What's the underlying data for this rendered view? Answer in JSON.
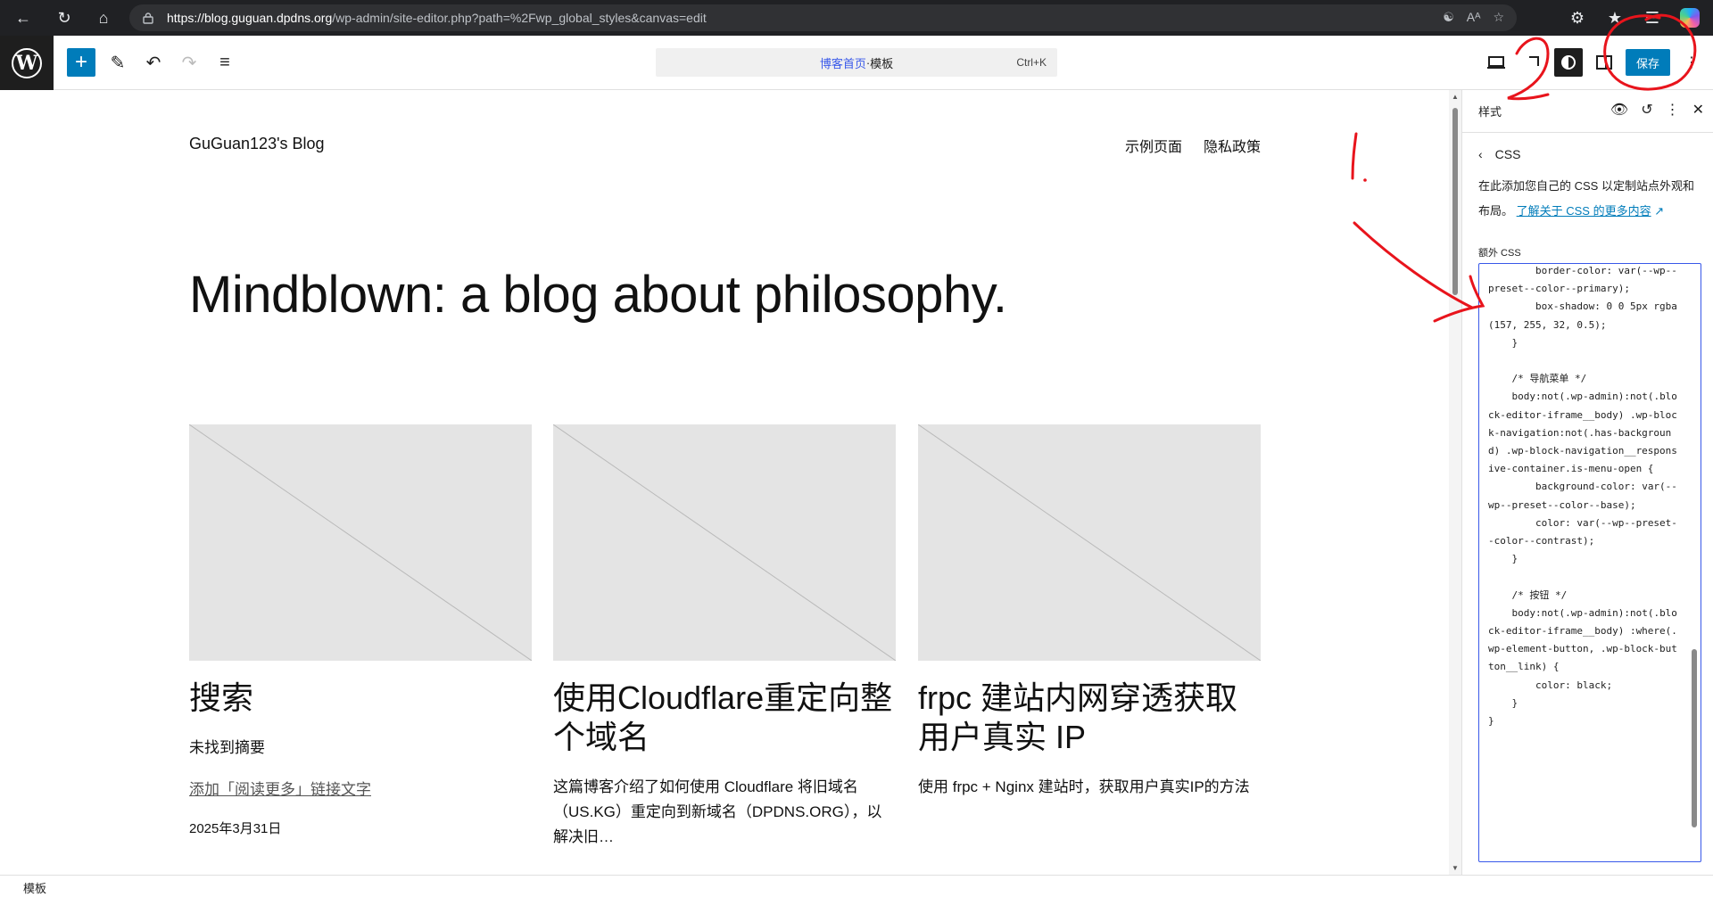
{
  "browser": {
    "url_host": "https://blog.guguan.dpdns.org",
    "url_path": "/wp-admin/site-editor.php?path=%2Fwp_global_styles&canvas=edit",
    "reader_mode_label": "Aᴬ"
  },
  "toolbar": {
    "command_home": "博客首页",
    "command_sep": " · ",
    "command_template": "模板",
    "command_shortcut": "Ctrl+K",
    "save_label": "保存"
  },
  "site": {
    "title": "GuGuan123's Blog",
    "nav": [
      "示例页面",
      "隐私政策"
    ],
    "tagline": "Mindblown: a blog about philosophy."
  },
  "posts": [
    {
      "title": "搜索",
      "excerpt": "未找到摘要",
      "read_more": "添加「阅读更多」链接文字",
      "date": "2025年3月31日"
    },
    {
      "title": "使用Cloudflare重定向整个域名",
      "excerpt": "这篇博客介绍了如何使用 Cloudflare 将旧域名（US.KG）重定向到新域名（DPDNS.ORG），以解决旧…"
    },
    {
      "title": "frpc 建站内网穿透获取用户真实 IP",
      "excerpt": "使用 frpc + Nginx 建站时，获取用户真实IP的方法"
    }
  ],
  "sidebar": {
    "header": "样式",
    "subheader": "CSS",
    "description": "在此添加您自己的 CSS 以定制站点外观和布局。",
    "learn_more": "了解关于 CSS 的更多内容",
    "extra_css_label": "额外 CSS",
    "css_code": "        border-color: var(--wp--preset--color--primary);\n        box-shadow: 0 0 5px rgba(157, 255, 32, 0.5);\n    }\n\n    /* 导航菜单 */\n    body:not(.wp-admin):not(.block-editor-iframe__body) .wp-block-navigation:not(.has-background) .wp-block-navigation__responsive-container.is-menu-open {\n        background-color: var(--wp--preset--color--base);\n        color: var(--wp--preset--color--contrast);\n    }\n\n    /* 按钮 */\n    body:not(.wp-admin):not(.block-editor-iframe__body) :where(.wp-element-button, .wp-block-button__link) {\n        color: black;\n    }\n}"
  },
  "footer": {
    "breadcrumb": "模板"
  },
  "annotations": {
    "step_label": "1."
  },
  "colors": {
    "accent": "#007cba",
    "wp_dark": "#1e1e1e",
    "annotation_red": "#e8141c",
    "placeholder_gray": "#e4e4e4"
  }
}
